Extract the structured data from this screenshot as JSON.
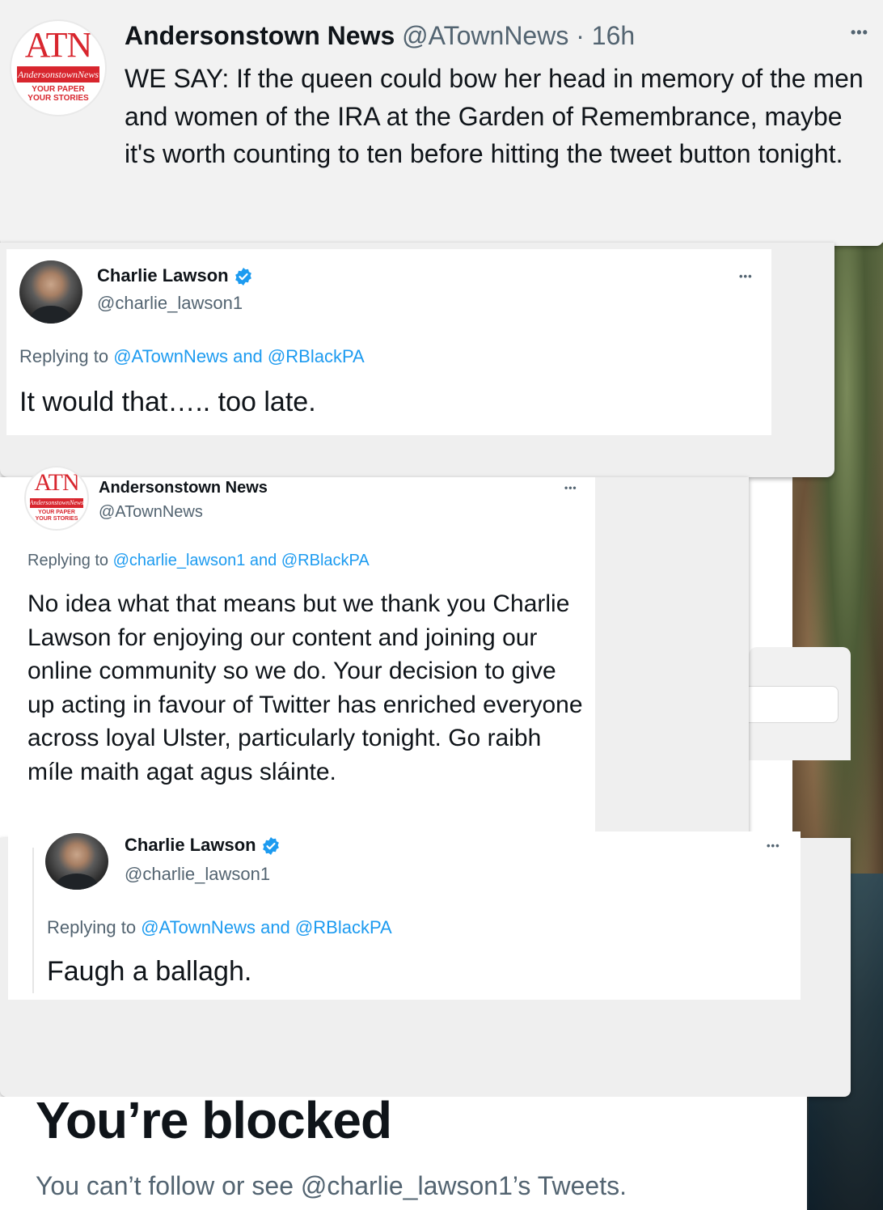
{
  "main_tweet": {
    "logo": {
      "letters": "ATN",
      "wordmark": "AndersonstownNews",
      "tagline_1": "YOUR PAPER",
      "tagline_2": "YOUR STORIES"
    },
    "display_name": "Andersonstown News",
    "handle": "@ATownNews",
    "separator": "·",
    "time": "16h",
    "more": "•••",
    "text": "WE SAY: If the queen could bow her head in memory of the men and women of the IRA at the Garden of Remembrance, maybe it's worth counting to ten before hitting the tweet button tonight."
  },
  "reply_1": {
    "display_name": "Charlie Lawson",
    "handle": "@charlie_lawson1",
    "more": "•••",
    "replying_prefix": "Replying to",
    "replying_handle_1": "@ATownNews",
    "replying_and": "and",
    "replying_handle_2": "@RBlackPA",
    "text": "It would that….. too late."
  },
  "reply_2": {
    "logo": {
      "letters": "ATN",
      "wordmark": "AndersonstownNews",
      "tagline_1": "YOUR PAPER",
      "tagline_2": "YOUR STORIES"
    },
    "display_name": "Andersonstown News",
    "handle": "@ATownNews",
    "more": "•••",
    "replying_prefix": "Replying to",
    "replying_handle_1": "@charlie_lawson1",
    "replying_and": "and",
    "replying_handle_2": "@RBlackPA",
    "text": "No idea what that means but we thank you Charlie Lawson for enjoying our content and joining our online community so we do. Your decision to give up acting in favour of Twitter has enriched everyone across loyal Ulster, particularly tonight. Go raibh míle maith agat agus sláinte."
  },
  "reply_3": {
    "display_name": "Charlie Lawson",
    "handle": "@charlie_lawson1",
    "more": "•••",
    "replying_prefix": "Replying to",
    "replying_handle_1": "@ATownNews",
    "replying_and": "and",
    "replying_handle_2": "@RBlackPA",
    "text": "Faugh a ballagh."
  },
  "blocked": {
    "title": "You’re blocked",
    "message": "You can’t follow or see @charlie_lawson1’s Tweets."
  },
  "colors": {
    "link": "#1d9bf0",
    "text": "#0f1419",
    "muted": "#536471",
    "brand_red": "#d8262e"
  }
}
